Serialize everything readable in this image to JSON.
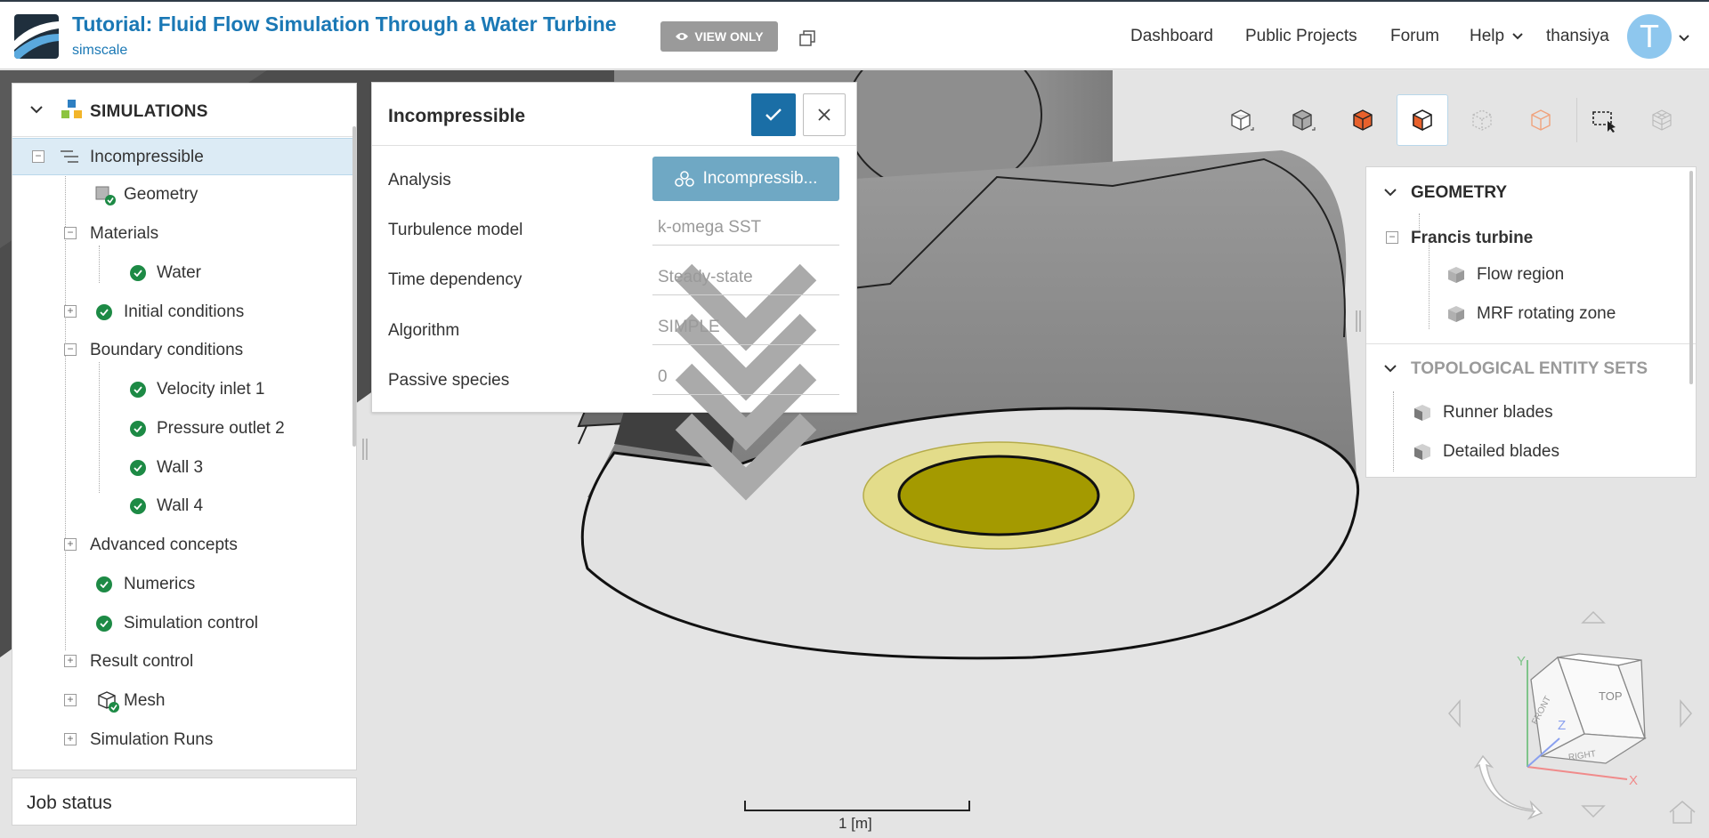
{
  "header": {
    "project_title": "Tutorial: Fluid Flow Simulation Through a Water Turbine",
    "project_owner": "simscale",
    "view_only_label": "VIEW ONLY",
    "nav": {
      "dashboard": "Dashboard",
      "public_projects": "Public Projects",
      "forum": "Forum",
      "help": "Help",
      "username": "thansiya"
    },
    "avatar_letter": "T",
    "brand_color": "#1a78b5"
  },
  "simulation_tree": {
    "section_title": "SIMULATIONS",
    "items": {
      "incompressible": "Incompressible",
      "geometry": "Geometry",
      "materials": "Materials",
      "water": "Water",
      "initial_conditions": "Initial conditions",
      "boundary_conditions": "Boundary conditions",
      "velocity_inlet": "Velocity inlet 1",
      "pressure_outlet": "Pressure outlet 2",
      "wall3": "Wall 3",
      "wall4": "Wall 4",
      "advanced_concepts": "Advanced concepts",
      "numerics": "Numerics",
      "simulation_control": "Simulation control",
      "result_control": "Result control",
      "mesh": "Mesh",
      "simulation_runs": "Simulation Runs"
    },
    "status_color": "#1d8a45"
  },
  "job_status": {
    "title": "Job status"
  },
  "dialog": {
    "title": "Incompressible",
    "analysis_label": "Analysis",
    "analysis_value": "Incompressib...",
    "fields": {
      "turbulence": {
        "label": "Turbulence model",
        "value": "k-omega SST"
      },
      "time": {
        "label": "Time dependency",
        "value": "Steady-state"
      },
      "algorithm": {
        "label": "Algorithm",
        "value": "SIMPLE"
      },
      "passive": {
        "label": "Passive species",
        "value": "0"
      }
    }
  },
  "geometry_panel": {
    "geometry_title": "GEOMETRY",
    "root": "Francis turbine",
    "flow_region": "Flow region",
    "mrf_zone": "MRF rotating zone",
    "topo_title": "TOPOLOGICAL ENTITY SETS",
    "runner_blades": "Runner blades",
    "detailed_blades": "Detailed blades"
  },
  "view_cube": {
    "top": "TOP",
    "front": "FRONT",
    "right": "RIGHT",
    "axis_x": "X",
    "axis_y": "Y",
    "axis_z": "Z"
  },
  "scale": {
    "label": "1 [m]"
  }
}
